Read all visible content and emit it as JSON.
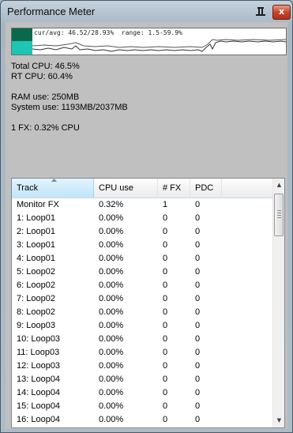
{
  "window": {
    "title": "Performance Meter",
    "close_glyph": "x",
    "pin_icon": "pin-icon"
  },
  "graph": {
    "overlay_text": "cur/avg: 46.52/28.93%  range: 1.5-59.9%",
    "colors": {
      "swatch_top": "#09694d",
      "swatch_bottom": "#1dc6b4"
    }
  },
  "stats": {
    "total_cpu": "Total CPU: 46.5%",
    "rt_cpu": "RT CPU: 60.4%",
    "ram_use": "RAM use: 250MB",
    "system_use": "System use: 1193MB/2037MB",
    "fx_cpu": "1 FX: 0.32% CPU"
  },
  "table": {
    "columns": [
      "Track",
      "CPU use",
      "# FX",
      "PDC"
    ],
    "sorted_column": "Track",
    "rows": [
      [
        "Monitor FX",
        "0.32%",
        "1",
        "0"
      ],
      [
        "1: Loop01",
        "0.00%",
        "0",
        "0"
      ],
      [
        "2: Loop01",
        "0.00%",
        "0",
        "0"
      ],
      [
        "3: Loop01",
        "0.00%",
        "0",
        "0"
      ],
      [
        "4: Loop01",
        "0.00%",
        "0",
        "0"
      ],
      [
        "5: Loop02",
        "0.00%",
        "0",
        "0"
      ],
      [
        "6: Loop02",
        "0.00%",
        "0",
        "0"
      ],
      [
        "7: Loop02",
        "0.00%",
        "0",
        "0"
      ],
      [
        "8: Loop02",
        "0.00%",
        "0",
        "0"
      ],
      [
        "9: Loop03",
        "0.00%",
        "0",
        "0"
      ],
      [
        "10: Loop03",
        "0.00%",
        "0",
        "0"
      ],
      [
        "11: Loop03",
        "0.00%",
        "0",
        "0"
      ],
      [
        "12: Loop03",
        "0.00%",
        "0",
        "0"
      ],
      [
        "13: Loop04",
        "0.00%",
        "0",
        "0"
      ],
      [
        "14: Loop04",
        "0.00%",
        "0",
        "0"
      ],
      [
        "15: Loop04",
        "0.00%",
        "0",
        "0"
      ],
      [
        "16: Loop04",
        "0.00%",
        "0",
        "0"
      ]
    ]
  }
}
